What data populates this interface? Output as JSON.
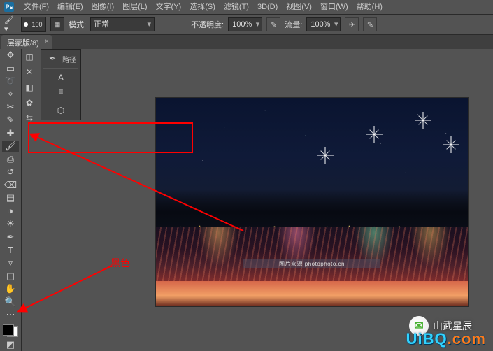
{
  "app": {
    "logo": "Ps"
  },
  "menu": {
    "file": "文件(F)",
    "edit": "编辑(E)",
    "image": "图像(I)",
    "layer": "图层(L)",
    "type": "文字(Y)",
    "select": "选择(S)",
    "filter": "滤镜(T)",
    "threeD": "3D(D)",
    "view": "视图(V)",
    "window": "窗口(W)",
    "help": "帮助(H)"
  },
  "options": {
    "brush_size": "100",
    "mode_label": "模式:",
    "mode_value": "正常",
    "opacity_label": "不透明度:",
    "opacity_value": "100%",
    "flow_label": "流量:",
    "flow_value": "100%"
  },
  "doc_tab": {
    "title": "层蒙版/8)",
    "close": "×"
  },
  "floating_panel": {
    "path_label": "路径",
    "icon_pen": "✒",
    "icon_a": "A",
    "icon_align": "≡",
    "icon_cube": "⬡"
  },
  "tools": {
    "move": "✥",
    "marquee": "▭",
    "lasso": "➰",
    "wand": "✧",
    "crop": "✂",
    "eyedropper": "✎",
    "heal": "✚",
    "brush": "🖌",
    "stamp": "⎙",
    "history": "↺",
    "eraser": "⌫",
    "gradient": "▤",
    "blur": "◑",
    "dodge": "☀",
    "pen": "✒",
    "type": "T",
    "path": "▿",
    "rect": "▢",
    "hand": "✋",
    "zoom": "🔍",
    "ellipsis": "⋯",
    "quickmask": "◩"
  },
  "mini_tools": {
    "a": "◫",
    "b": "✕",
    "c": "◧",
    "d": "✿",
    "e": "⇆"
  },
  "annotation": {
    "label": "黑色"
  },
  "canvas": {
    "watermark": "图片来源 photophoto.cn"
  },
  "badges": {
    "wechat_text": "山武星辰",
    "site": "UiBQ",
    "site_suffix": ".com"
  },
  "colors": {
    "red": "#ff0000",
    "accent": "#30d2ff",
    "orange": "#ff7a1a"
  }
}
